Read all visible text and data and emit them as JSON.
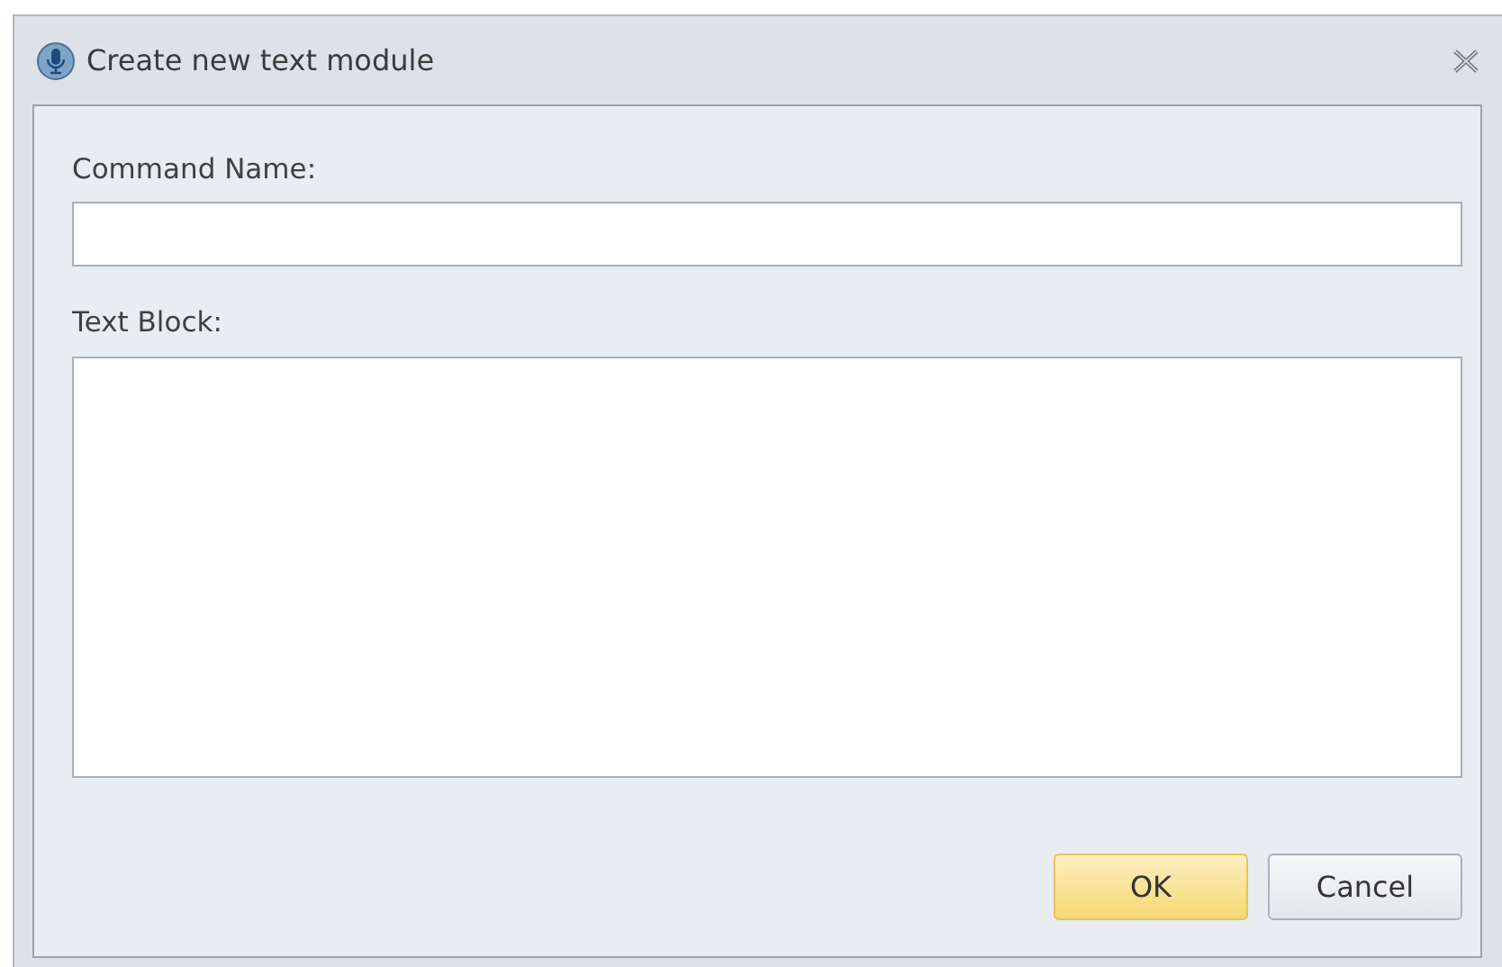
{
  "window": {
    "title": "Create new text module"
  },
  "fields": [
    {
      "label": "Command Name:",
      "kind": "input"
    },
    {
      "label": "Text Block:",
      "kind": "textarea"
    }
  ],
  "buttons": [
    {
      "label": "OK",
      "default": true
    },
    {
      "label": "Cancel",
      "default": false
    }
  ]
}
